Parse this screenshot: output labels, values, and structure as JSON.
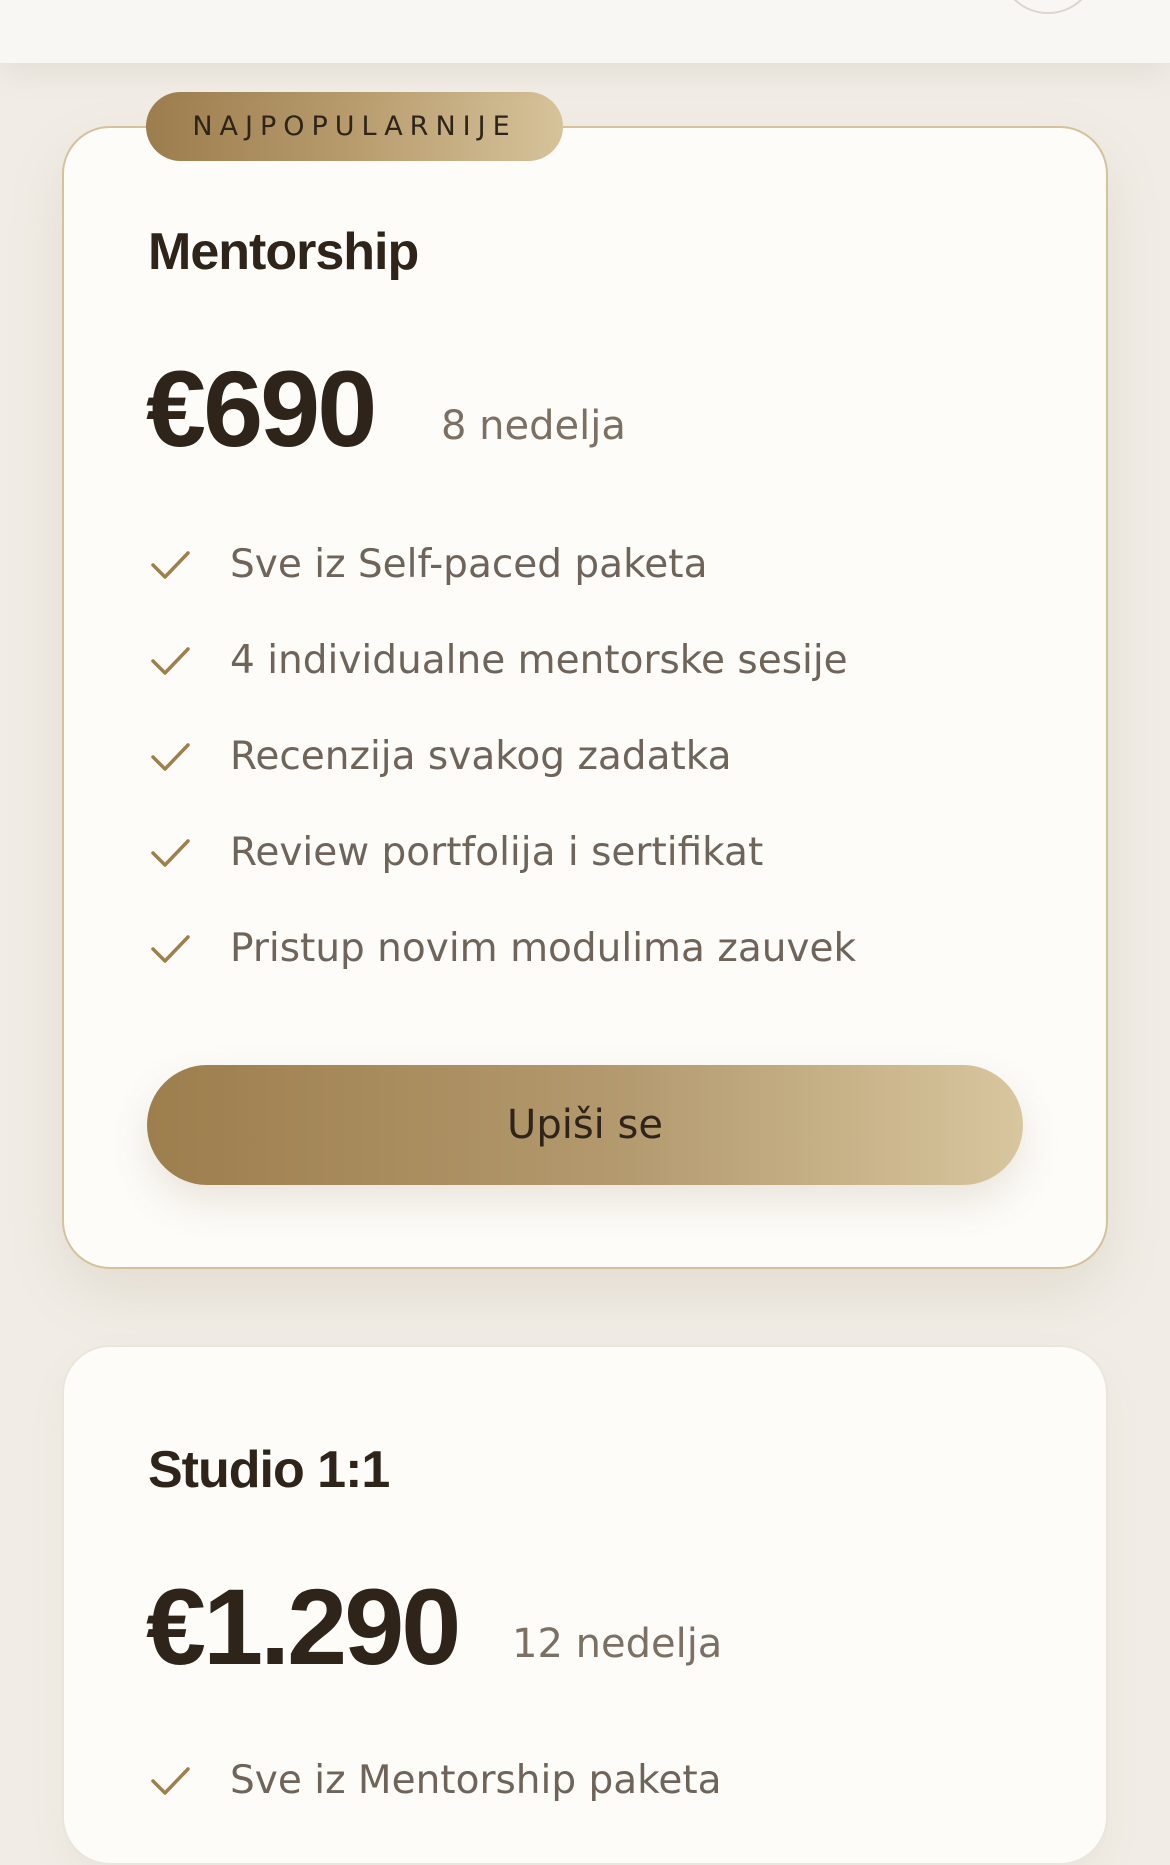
{
  "accent": {
    "gold_start": "#9c7d4d",
    "gold_end": "#d6c39a",
    "text_dark": "#2e241a",
    "text_muted": "#6f645a"
  },
  "plans": [
    {
      "badge": "NAJPOPULARNIJE",
      "name": "Mentorship",
      "price": "€690",
      "period": "8 nedelja",
      "features": [
        "Sve iz Self-paced paketa",
        "4 individualne mentorske sesije",
        "Recenzija svakog zadatka",
        "Review portfolija i sertifikat",
        "Pristup novim modulima zauvek"
      ],
      "cta": "Upiši se"
    },
    {
      "name": "Studio 1:1",
      "price": "€1.290",
      "period": "12 nedelja",
      "features": [
        "Sve iz Mentorship paketa"
      ]
    }
  ],
  "icons": {
    "feature_check": "check-icon"
  }
}
